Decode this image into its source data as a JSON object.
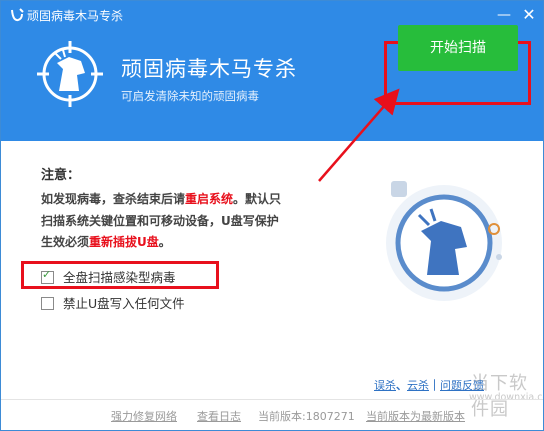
{
  "window": {
    "title": "顽固病毒木马专杀",
    "minimize_icon": "minimize-icon",
    "close_icon": "close-icon"
  },
  "header": {
    "app_title": "顽固病毒木马专杀",
    "subtitle": "可启发清除未知的顽固病毒",
    "scan_button_label": "开始扫描",
    "logo_icon": "horse-crosshair-logo-icon",
    "accent_color": "#2f8ae6",
    "button_color": "#27bd3b",
    "highlight_color": "#e8101c"
  },
  "notice": {
    "title": "注意：",
    "line1_prefix": "如发现病毒，查杀结束后请",
    "line1_red": "重启系统",
    "line1_suffix": "。默认只",
    "line2": "扫描系统关键位置和可移动设备，U盘写保护",
    "line3_prefix": "生效必须",
    "line3_red": "重新插拔U盘",
    "line3_suffix": "。"
  },
  "options": [
    {
      "label": "全盘扫描感染型病毒",
      "checked": true
    },
    {
      "label": "禁止U盘写入任何文件",
      "checked": false
    }
  ],
  "side_links": {
    "item1": "误杀",
    "sep1": "、",
    "item2": "云杀",
    "sep2": "｜",
    "item3": "问题",
    "item4": "反馈"
  },
  "watermark": {
    "name": "当下软件园",
    "url": "www.downxia.com"
  },
  "footer": {
    "link_repair": "强力修复网络",
    "link_log": "查看日志",
    "version_text": "当前版本:1807271",
    "version_status": "当前版本为最新版本"
  }
}
